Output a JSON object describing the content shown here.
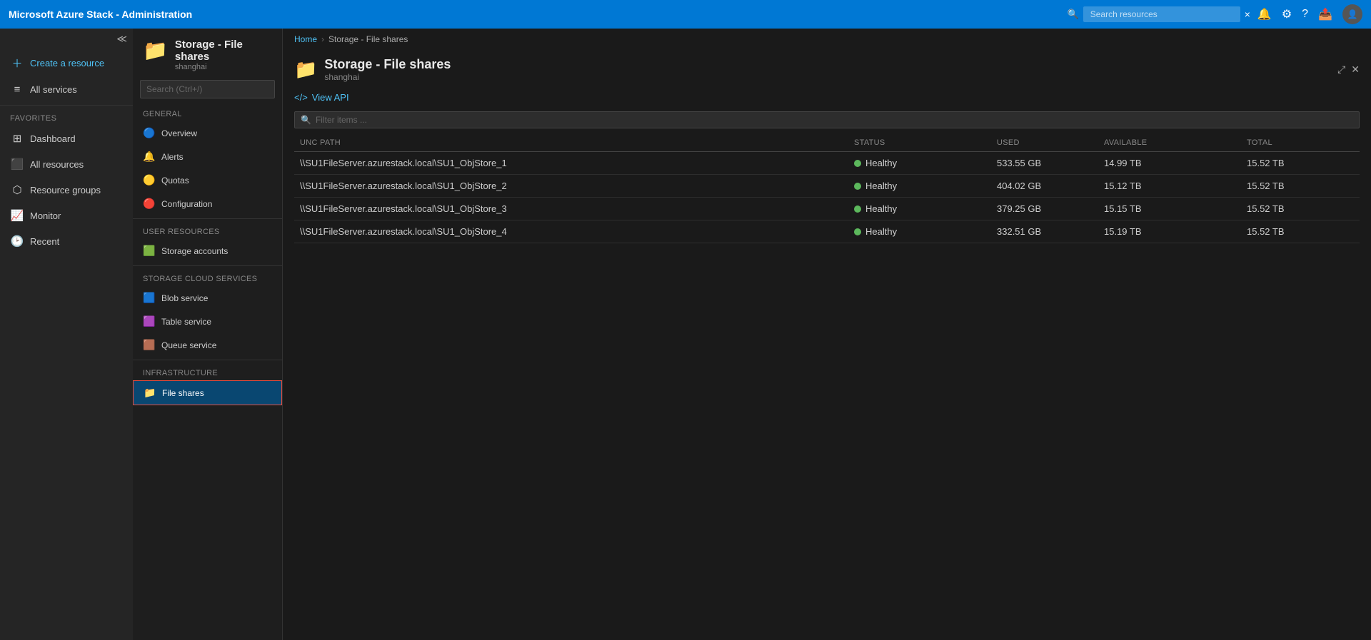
{
  "topbar": {
    "title": "Microsoft Azure Stack - Administration",
    "search_placeholder": "Search resources",
    "search_close": "×"
  },
  "left_nav": {
    "create_label": "Create a resource",
    "all_services_label": "All services",
    "favorites_section": "Favorites",
    "items": [
      {
        "id": "dashboard",
        "label": "Dashboard",
        "icon": "⊞"
      },
      {
        "id": "all-resources",
        "label": "All resources",
        "icon": "⬛"
      },
      {
        "id": "resource-groups",
        "label": "Resource groups",
        "icon": "⬡"
      },
      {
        "id": "monitor",
        "label": "Monitor",
        "icon": "📈"
      },
      {
        "id": "recent",
        "label": "Recent",
        "icon": "🕑"
      }
    ]
  },
  "secondary_panel": {
    "title": "Storage - File shares",
    "subtitle": "shanghai",
    "folder_icon": "📁",
    "search_placeholder": "Search (Ctrl+/)",
    "sections": [
      {
        "header": "General",
        "items": [
          {
            "id": "overview",
            "label": "Overview",
            "icon": "🔵",
            "active": false
          },
          {
            "id": "alerts",
            "label": "Alerts",
            "icon": "🔔",
            "active": false
          },
          {
            "id": "quotas",
            "label": "Quotas",
            "icon": "🟡",
            "active": false
          },
          {
            "id": "configuration",
            "label": "Configuration",
            "icon": "🔴",
            "active": false
          }
        ]
      },
      {
        "header": "User Resources",
        "items": [
          {
            "id": "storage-accounts",
            "label": "Storage accounts",
            "icon": "🟩",
            "active": false
          }
        ]
      },
      {
        "header": "Storage Cloud Services",
        "items": [
          {
            "id": "blob-service",
            "label": "Blob service",
            "icon": "🟦",
            "active": false
          },
          {
            "id": "table-service",
            "label": "Table service",
            "icon": "🟪",
            "active": false
          },
          {
            "id": "queue-service",
            "label": "Queue service",
            "icon": "🟫",
            "active": false
          }
        ]
      },
      {
        "header": "Infrastructure",
        "items": [
          {
            "id": "file-shares",
            "label": "File shares",
            "icon": "📁",
            "active": true
          }
        ]
      }
    ]
  },
  "breadcrumb": {
    "items": [
      {
        "label": "Home",
        "link": true
      },
      {
        "label": "Storage - File shares",
        "link": false
      }
    ]
  },
  "content": {
    "title": "Storage - File shares",
    "subtitle": "shanghai",
    "view_api_label": "View API",
    "filter_placeholder": "Filter items ...",
    "table": {
      "columns": [
        "UNC PATH",
        "STATUS",
        "USED",
        "AVAILABLE",
        "TOTAL"
      ],
      "rows": [
        {
          "unc_path": "\\\\SU1FileServer.azurestack.local\\SU1_ObjStore_1",
          "status": "Healthy",
          "used": "533.55 GB",
          "available": "14.99 TB",
          "total": "15.52 TB"
        },
        {
          "unc_path": "\\\\SU1FileServer.azurestack.local\\SU1_ObjStore_2",
          "status": "Healthy",
          "used": "404.02 GB",
          "available": "15.12 TB",
          "total": "15.52 TB"
        },
        {
          "unc_path": "\\\\SU1FileServer.azurestack.local\\SU1_ObjStore_3",
          "status": "Healthy",
          "used": "379.25 GB",
          "available": "15.15 TB",
          "total": "15.52 TB"
        },
        {
          "unc_path": "\\\\SU1FileServer.azurestack.local\\SU1_ObjStore_4",
          "status": "Healthy",
          "used": "332.51 GB",
          "available": "15.19 TB",
          "total": "15.52 TB"
        }
      ]
    }
  }
}
